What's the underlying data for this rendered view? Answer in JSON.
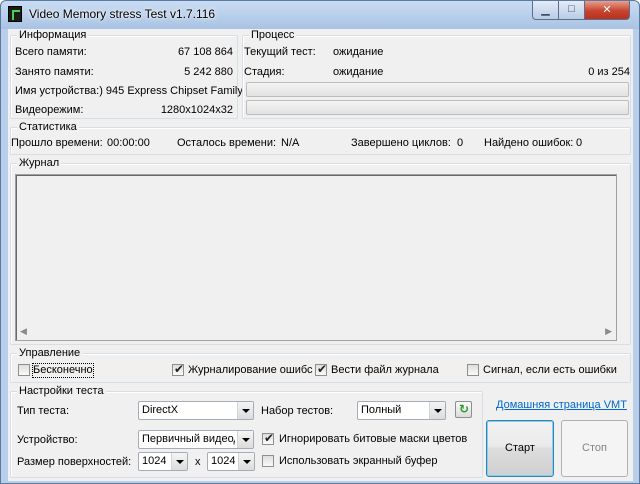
{
  "window": {
    "title": "Video Memory stress Test v1.7.116"
  },
  "info": {
    "legend": "Информация",
    "rows": [
      {
        "label": "Всего памяти:",
        "value": "67 108 864"
      },
      {
        "label": "Занято памяти:",
        "value": "5 242 880"
      },
      {
        "label": "Имя устройства:) 945 Express Chipset Family",
        "value": ""
      },
      {
        "label": "Видеорежим:",
        "value": "1280x1024x32"
      }
    ]
  },
  "process": {
    "legend": "Процесс",
    "current_test_label": "Текущий тест:",
    "current_test_value": "ожидание",
    "stage_label": "Стадия:",
    "stage_value": "ожидание",
    "stage_counter": "0 из 254",
    "progress1": 0,
    "progress2": 0
  },
  "stats": {
    "legend": "Статистика",
    "elapsed_label": "Прошло времени:",
    "elapsed_value": "00:00:00",
    "remaining_label": "Осталось времени:",
    "remaining_value": "N/A",
    "cycles_label": "Завершено циклов:",
    "cycles_value": "0",
    "errors_label": "Найдено ошибок:",
    "errors_value": "0"
  },
  "log": {
    "legend": "Журнал"
  },
  "control": {
    "legend": "Управление",
    "endless": {
      "label": "Бесконечно",
      "checked": false
    },
    "log_errors": {
      "label": "Журналирование ошибс",
      "checked": true
    },
    "log_file": {
      "label": "Вести файл журнала",
      "checked": true
    },
    "signal": {
      "label": "Сигнал, если есть ошибки",
      "checked": false
    }
  },
  "settings": {
    "legend": "Настройки теста",
    "test_type_label": "Тип теста:",
    "test_type_value": "DirectX",
    "test_set_label": "Набор тестов:",
    "test_set_value": "Полный",
    "device_label": "Устройство:",
    "device_value": "Первичный видеод",
    "ignore_masks": {
      "label": "Игнорировать битовые маски цветов",
      "checked": true
    },
    "surface_label": "Размер поверхностей:",
    "width_value": "1024",
    "x_sep": "x",
    "height_value": "1024",
    "screen_buffer": {
      "label": "Использовать экранный буфер",
      "checked": false
    }
  },
  "homepage_link": "Домашняя страница VMT",
  "buttons": {
    "start": "Старт",
    "stop": "Стоп"
  },
  "icons": {
    "app": "vmt-app-icon",
    "refresh": "refresh-icon",
    "check": "✔"
  },
  "colors": {
    "link": "#0066cc",
    "check": "#222222",
    "refresh": "#2d9a2d"
  }
}
